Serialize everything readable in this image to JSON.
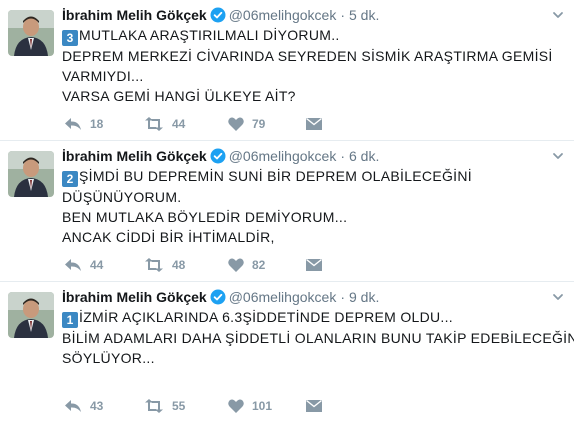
{
  "tweets": [
    {
      "name": "İbrahim Melih Gökçek",
      "handle": "@06melihgokcek",
      "separator": "·",
      "time": "5 dk.",
      "keycap": "3",
      "lines": [
        "MUTLAKA ARAŞTIRILMALI DİYORUM..",
        "DEPREM MERKEZİ CİVARINDA SEYREDEN SİSMİK ARAŞTIRMA GEMİSİ",
        "VARMIYDI...",
        "VARSA GEMİ HANGİ ÜLKEYE AİT?"
      ],
      "replies": "18",
      "retweets": "44",
      "likes": "79"
    },
    {
      "name": "İbrahim Melih Gökçek",
      "handle": "@06melihgokcek",
      "separator": "·",
      "time": "6 dk.",
      "keycap": "2",
      "lines": [
        "ŞİMDİ BU DEPREMİN SUNİ BİR DEPREM OLABİLECEĞİNİ",
        "DÜŞÜNÜYORUM.",
        "BEN MUTLAKA BÖYLEDİR DEMİYORUM...",
        "ANCAK CİDDİ BİR İHTİMALDİR,"
      ],
      "replies": "44",
      "retweets": "48",
      "likes": "82"
    },
    {
      "name": "İbrahim Melih Gökçek",
      "handle": "@06melihgokcek",
      "separator": "·",
      "time": "9 dk.",
      "keycap": "1",
      "lines": [
        "İZMİR AÇIKLARINDA 6.3ŞİDDETİNDE DEPREM OLDU...",
        "BİLİM ADAMLARI DAHA ŞİDDETLİ OLANLARIN BUNU TAKİP EDEBİLECEĞİNİ",
        "SÖYLÜYOR..."
      ],
      "replies": "43",
      "retweets": "55",
      "likes": "101"
    }
  ],
  "colors": {
    "verified_badge": "#1da1f2",
    "keycap": "#3b88c3",
    "action_icons": "#8899a6",
    "muted_text": "#657786",
    "divider": "#e6ecf0"
  },
  "icons": {
    "verified": "verified-badge-icon",
    "caret": "chevron-down-icon",
    "reply": "reply-icon",
    "retweet": "retweet-icon",
    "like": "heart-icon",
    "message": "envelope-icon"
  }
}
